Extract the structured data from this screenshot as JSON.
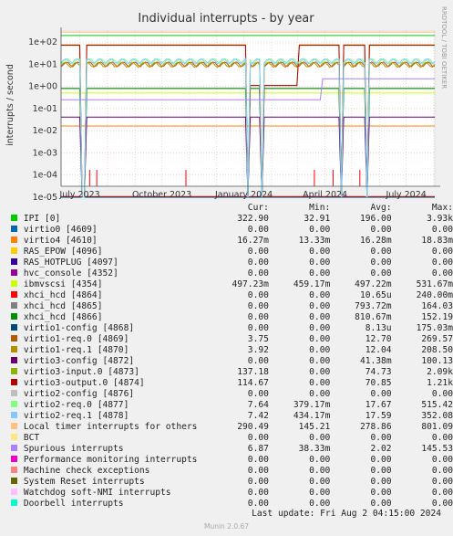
{
  "chart_data": {
    "type": "line",
    "title": "Individual interrupts - by year",
    "ylabel": "interrupts / second",
    "side_label": "RRDTOOL / TOBI OETIKER",
    "y_scale": "log",
    "ylim": [
      "1e-05",
      "1e+02"
    ],
    "y_ticks": [
      "1e+02",
      "1e+01",
      "1e+00",
      "1e-01",
      "1e-02",
      "1e-03",
      "1e-04",
      "1e-05"
    ],
    "x_ticks": [
      "July 2023",
      "October 2023",
      "January 2024",
      "April 2024",
      "July 2024"
    ],
    "grid": true,
    "legend_placement": "bottom",
    "columns": [
      "Cur:",
      "Min:",
      "Avg:",
      "Max:"
    ],
    "series": [
      {
        "name": "IPI [0]",
        "color": "#00cc00",
        "cur": "322.90",
        "min": "32.91",
        "avg": "196.00",
        "max": "3.93k"
      },
      {
        "name": "virtio0 [4609]",
        "color": "#0066b3",
        "cur": "0.00",
        "min": "0.00",
        "avg": "0.00",
        "max": "0.00"
      },
      {
        "name": "virtio4 [4610]",
        "color": "#ff8000",
        "cur": "16.27m",
        "min": "13.33m",
        "avg": "16.28m",
        "max": "18.83m"
      },
      {
        "name": "RAS_EPOW [4096]",
        "color": "#ffcc00",
        "cur": "0.00",
        "min": "0.00",
        "avg": "0.00",
        "max": "0.00"
      },
      {
        "name": "RAS_HOTPLUG [4097]",
        "color": "#330099",
        "cur": "0.00",
        "min": "0.00",
        "avg": "0.00",
        "max": "0.00"
      },
      {
        "name": "hvc_console [4352]",
        "color": "#990099",
        "cur": "0.00",
        "min": "0.00",
        "avg": "0.00",
        "max": "0.00"
      },
      {
        "name": "ibmvscsi [4354]",
        "color": "#ccff00",
        "cur": "497.23m",
        "min": "459.17m",
        "avg": "497.22m",
        "max": "531.67m"
      },
      {
        "name": "xhci_hcd [4864]",
        "color": "#ff0000",
        "cur": "0.00",
        "min": "0.00",
        "avg": "10.65u",
        "max": "240.00m"
      },
      {
        "name": "xhci_hcd [4865]",
        "color": "#808080",
        "cur": "0.00",
        "min": "0.00",
        "avg": "793.72m",
        "max": "164.03"
      },
      {
        "name": "xhci_hcd [4866]",
        "color": "#008f00",
        "cur": "0.00",
        "min": "0.00",
        "avg": "810.67m",
        "max": "152.19"
      },
      {
        "name": "virtio1-config [4868]",
        "color": "#00487d",
        "cur": "0.00",
        "min": "0.00",
        "avg": "8.13u",
        "max": "175.03m"
      },
      {
        "name": "virtio1-req.0 [4869]",
        "color": "#b35a00",
        "cur": "3.75",
        "min": "0.00",
        "avg": "12.70",
        "max": "269.57"
      },
      {
        "name": "virtio1-req.1 [4870]",
        "color": "#b38f00",
        "cur": "3.92",
        "min": "0.00",
        "avg": "12.04",
        "max": "208.50"
      },
      {
        "name": "virtio3-config [4872]",
        "color": "#6b006b",
        "cur": "0.00",
        "min": "0.00",
        "avg": "41.38m",
        "max": "100.13"
      },
      {
        "name": "virtio3-input.0 [4873]",
        "color": "#8fb300",
        "cur": "137.18",
        "min": "0.00",
        "avg": "74.73",
        "max": "2.09k"
      },
      {
        "name": "virtio3-output.0 [4874]",
        "color": "#b30000",
        "cur": "114.67",
        "min": "0.00",
        "avg": "70.85",
        "max": "1.21k"
      },
      {
        "name": "virtio2-config [4876]",
        "color": "#bebebe",
        "cur": "0.00",
        "min": "0.00",
        "avg": "0.00",
        "max": "0.00"
      },
      {
        "name": "virtio2-req.0 [4877]",
        "color": "#80ff80",
        "cur": "7.64",
        "min": "379.17m",
        "avg": "17.67",
        "max": "515.42"
      },
      {
        "name": "virtio2-req.1 [4878]",
        "color": "#80c9ff",
        "cur": "7.42",
        "min": "434.17m",
        "avg": "17.59",
        "max": "352.08"
      },
      {
        "name": "Local timer interrupts for others",
        "color": "#ffc080",
        "cur": "290.49",
        "min": "145.21",
        "avg": "278.86",
        "max": "801.09"
      },
      {
        "name": "BCT",
        "color": "#ffe680",
        "cur": "0.00",
        "min": "0.00",
        "avg": "0.00",
        "max": "0.00"
      },
      {
        "name": "Spurious interrupts",
        "color": "#aa80ff",
        "cur": "6.87",
        "min": "38.33m",
        "avg": "2.02",
        "max": "145.53"
      },
      {
        "name": "Performance monitoring interrupts",
        "color": "#ee00cc",
        "cur": "0.00",
        "min": "0.00",
        "avg": "0.00",
        "max": "0.00"
      },
      {
        "name": "Machine check exceptions",
        "color": "#ff8080",
        "cur": "0.00",
        "min": "0.00",
        "avg": "0.00",
        "max": "0.00"
      },
      {
        "name": "System Reset interrupts",
        "color": "#666600",
        "cur": "0.00",
        "min": "0.00",
        "avg": "0.00",
        "max": "0.00"
      },
      {
        "name": "Watchdog soft-NMI interrupts",
        "color": "#ffbfff",
        "cur": "0.00",
        "min": "0.00",
        "avg": "0.00",
        "max": "0.00"
      },
      {
        "name": "Doorbell interrupts",
        "color": "#00ffcc",
        "cur": "0.00",
        "min": "0.00",
        "avg": "0.00",
        "max": "0.00"
      }
    ]
  },
  "footer": {
    "last_update": "Last update: Fri Aug  2 04:15:00 2024",
    "generator": "Munin 2.0.67"
  }
}
